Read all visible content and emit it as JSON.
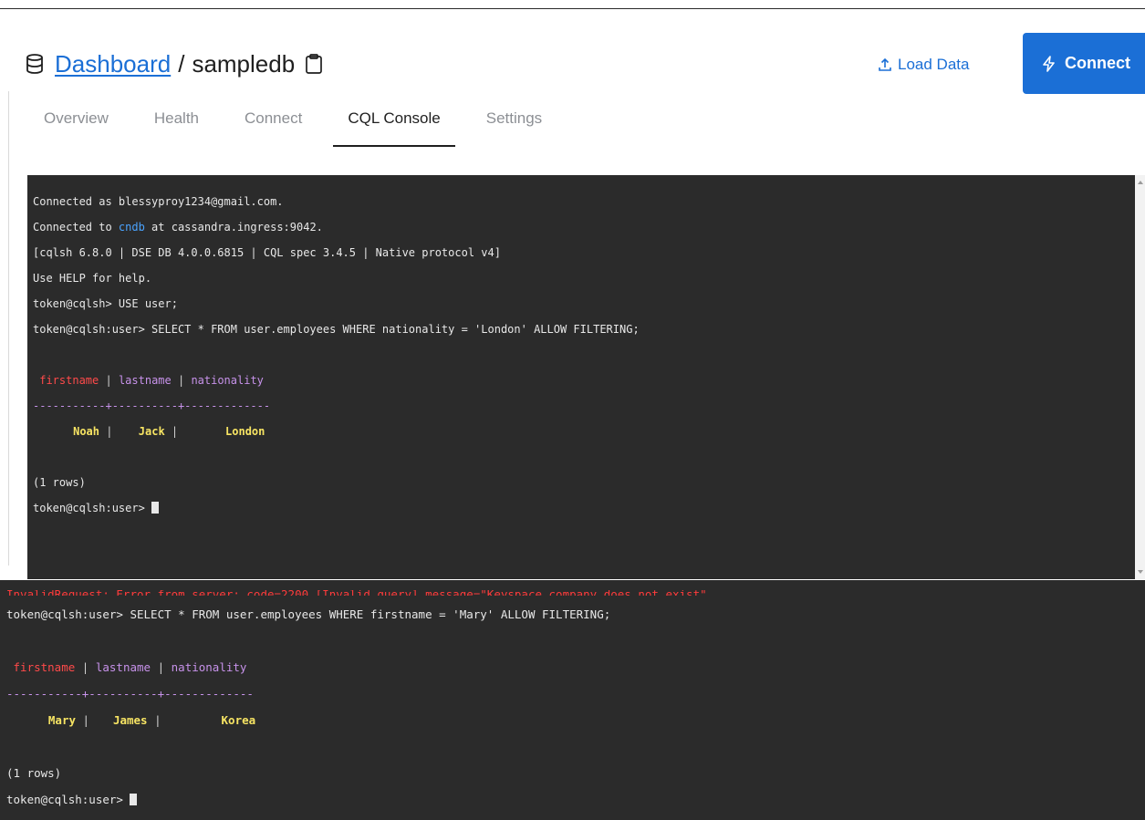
{
  "header": {
    "breadcrumb_link": "Dashboard",
    "separator": "/",
    "db_name": "sampledb",
    "load_data_label": "Load Data",
    "connect_label": "Connect",
    "icons": [
      "database-icon",
      "clipboard-icon",
      "upload-icon",
      "lightning-icon"
    ]
  },
  "tabs": [
    {
      "label": "Overview"
    },
    {
      "label": "Health"
    },
    {
      "label": "Connect"
    },
    {
      "label": "CQL Console",
      "active": true
    },
    {
      "label": "Settings"
    }
  ],
  "console1": {
    "line1_pre": "Connected as blessyproy1234@gmail.com.",
    "line2_a": "Connected to ",
    "line2_b": "cndb",
    "line2_c": " at cassandra.ingress:9042.",
    "line3": "[cqlsh 6.8.0 | DSE DB 4.0.0.6815 | CQL spec 3.4.5 | Native protocol v4]",
    "line4": "Use HELP for help.",
    "line5": "token@cqlsh> USE user;",
    "line6": "token@cqlsh:user> SELECT * FROM user.employees WHERE nationality = 'London' ALLOW FILTERING;",
    "header_c1": "firstname",
    "header_sep": " | ",
    "header_c2": "lastname",
    "header_c3": "nationality",
    "divider": "-----------+----------+-------------",
    "row_firstname": "Noah",
    "row_lastname": "Jack",
    "row_nationality": "London",
    "count": "(1 rows)",
    "prompt": "token@cqlsh:user> "
  },
  "console2": {
    "error_fragment": "InvalidRequest: Error from server: code=2200 [Invalid query] message=\"Keyspace company does not exist\"",
    "query": "token@cqlsh:user> SELECT * FROM user.employees WHERE firstname = 'Mary' ALLOW FILTERING;",
    "header_c1": "firstname",
    "header_sep": " | ",
    "header_c2": "lastname",
    "header_c3": "nationality",
    "divider": "-----------+----------+-------------",
    "row_firstname": "Mary",
    "row_lastname": "James",
    "row_nationality": "Korea",
    "count": "(1 rows)",
    "prompt": "token@cqlsh:user> "
  },
  "colors": {
    "accent": "#1b6fd6",
    "terminal_bg": "#2b2b2b",
    "column_key": "#ff4a4a",
    "column_header": "#c792ea",
    "row_value": "#f7e463"
  }
}
